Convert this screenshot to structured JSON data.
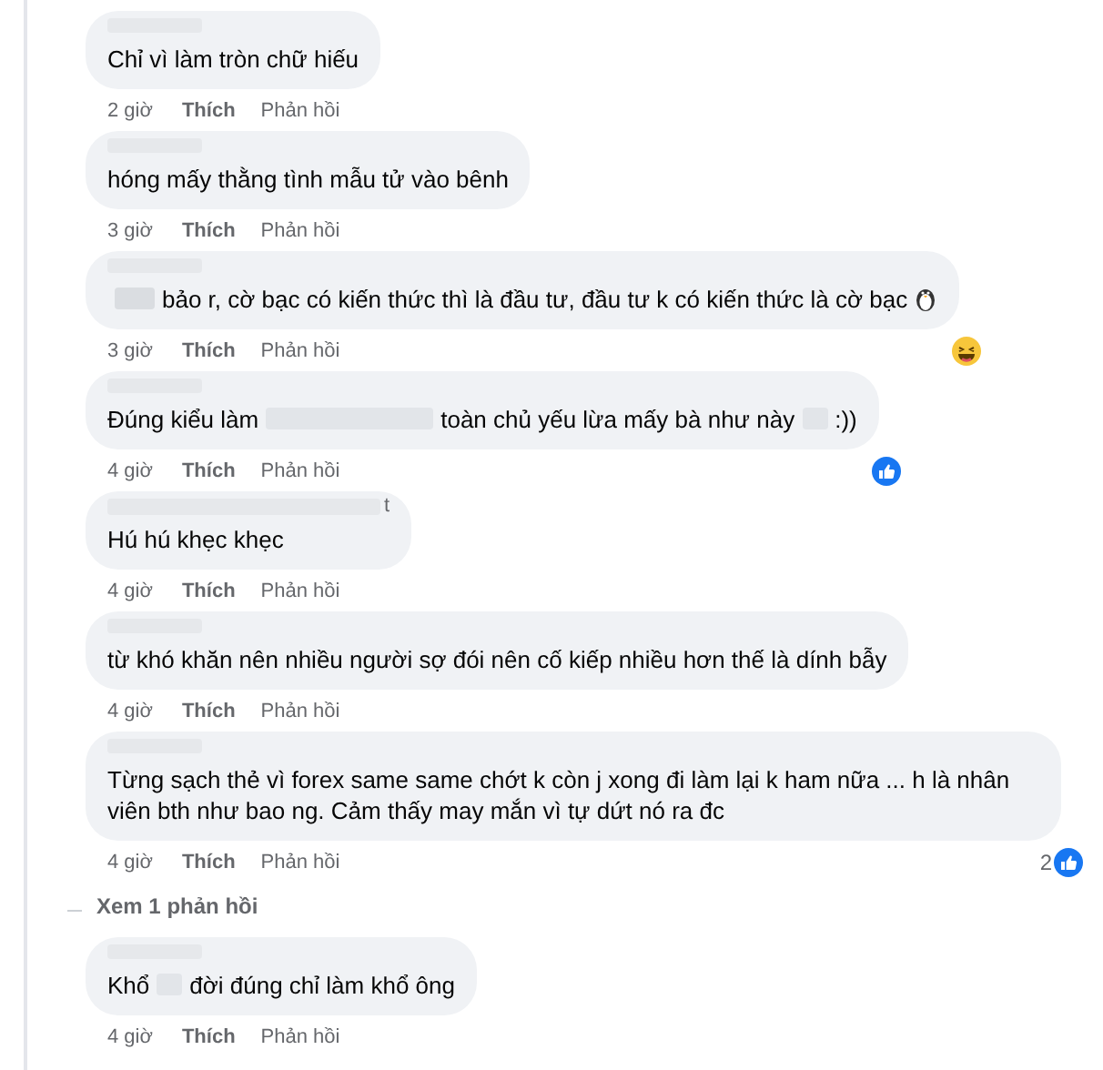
{
  "comments": [
    {
      "parts": [
        "Chỉ vì làm tròn chữ hiếu"
      ],
      "time": "2 giờ",
      "like": "Thích",
      "reply": "Phản hồi"
    },
    {
      "parts": [
        "hóng mấy thằng tình mẫu tử vào bênh"
      ],
      "time": "3 giờ",
      "like": "Thích",
      "reply": "Phản hồi"
    },
    {
      "parts": [
        "bảo r, cờ bạc có kiến thức thì là đầu tư, đầu tư k có kiến thức là cờ bạc"
      ],
      "lead_redacted": true,
      "trailing_icon": {
        "kind": "penguin"
      },
      "time": "3 giờ",
      "like": "Thích",
      "reply": "Phản hồi",
      "reaction": {
        "kind": "haha"
      }
    },
    {
      "parts": [
        "Đúng kiểu làm",
        "toàn chủ yếu lừa mấy bà như này",
        ":))"
      ],
      "time": "4 giờ",
      "like": "Thích",
      "reply": "Phản hồi",
      "reaction": {
        "kind": "like"
      }
    },
    {
      "parts": [
        "Hú hú khẹc khẹc"
      ],
      "name_tail": "t",
      "time": "4 giờ",
      "like": "Thích",
      "reply": "Phản hồi"
    },
    {
      "parts": [
        "từ khó khăn nên nhiều người sợ đói nên cố kiếp nhiều hơn thế là dính bẫy"
      ],
      "time": "4 giờ",
      "like": "Thích",
      "reply": "Phản hồi"
    },
    {
      "parts": [
        "Từng sạch thẻ vì forex same same chớt k còn j xong đi làm lại k ham nữa ... h là nhân viên bth như bao ng. Cảm thấy may mắn vì tự dứt nó ra đc"
      ],
      "time": "4 giờ",
      "like": "Thích",
      "reply": "Phản hồi",
      "reaction": {
        "kind": "like",
        "count": "2"
      },
      "view_replies": "Xem 1 phản hồi"
    },
    {
      "parts": [
        "Khổ",
        "đời đúng chỉ làm khổ ông"
      ],
      "time": "4 giờ",
      "like": "Thích",
      "reply": "Phản hồi"
    }
  ]
}
